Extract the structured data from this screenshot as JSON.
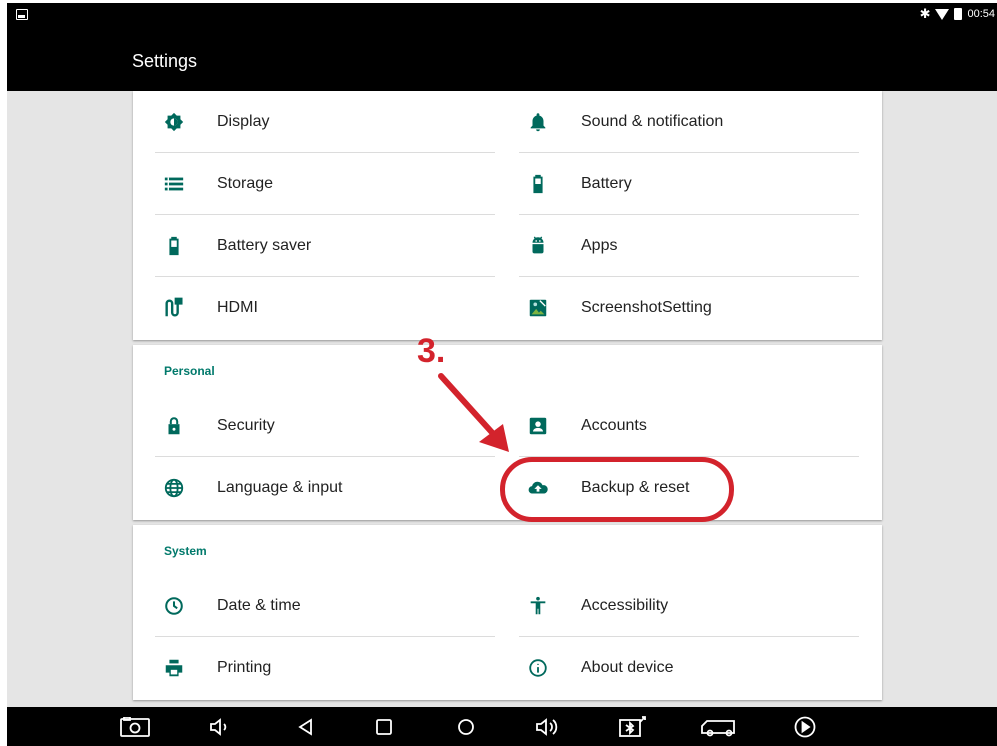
{
  "status_bar": {
    "time": "00:54"
  },
  "app_bar": {
    "title": "Settings"
  },
  "device_section": {
    "items": [
      {
        "label": "Display",
        "icon": "brightness-icon"
      },
      {
        "label": "Sound & notification",
        "icon": "bell-icon"
      },
      {
        "label": "Storage",
        "icon": "storage-list-icon"
      },
      {
        "label": "Battery",
        "icon": "battery-icon"
      },
      {
        "label": "Battery saver",
        "icon": "battery-saver-icon"
      },
      {
        "label": "Apps",
        "icon": "android-icon"
      },
      {
        "label": "HDMI",
        "icon": "hdmi-icon"
      },
      {
        "label": "ScreenshotSetting",
        "icon": "screenshot-icon"
      }
    ]
  },
  "personal_section": {
    "header": "Personal",
    "items": [
      {
        "label": "Security",
        "icon": "lock-icon"
      },
      {
        "label": "Accounts",
        "icon": "account-box-icon"
      },
      {
        "label": "Language & input",
        "icon": "globe-icon"
      },
      {
        "label": "Backup & reset",
        "icon": "cloud-upload-icon"
      }
    ]
  },
  "system_section": {
    "header": "System",
    "items": [
      {
        "label": "Date & time",
        "icon": "clock-icon"
      },
      {
        "label": "Accessibility",
        "icon": "accessibility-icon"
      },
      {
        "label": "Printing",
        "icon": "printer-icon"
      },
      {
        "label": "About device",
        "icon": "info-icon"
      }
    ]
  },
  "annotation": {
    "step": "3.",
    "color": "#d3232c"
  },
  "colors": {
    "accent": "#00695c",
    "header_text": "#00796b"
  }
}
